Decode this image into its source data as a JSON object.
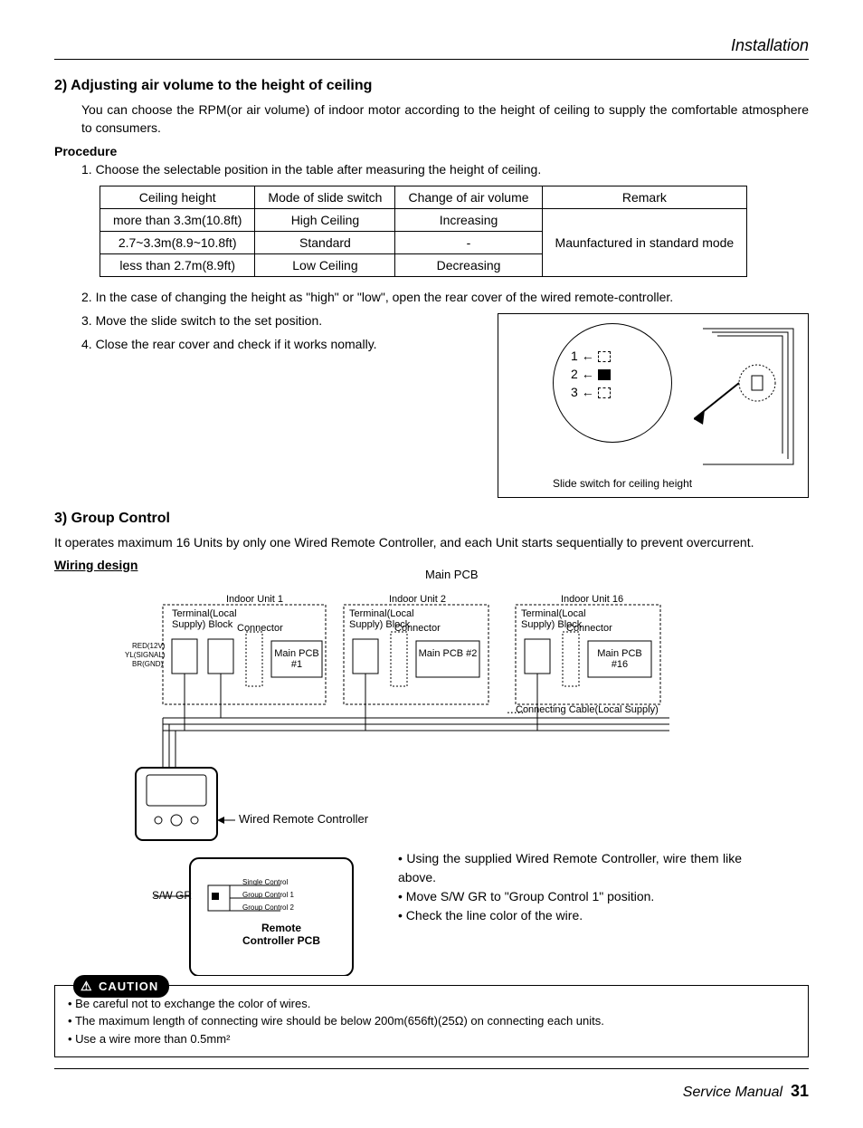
{
  "header": {
    "section": "Installation"
  },
  "s2": {
    "title": "2) Adjusting air volume to the height of ceiling",
    "intro": "You can choose the RPM(or air volume) of indoor motor according to the height of ceiling to supply the comfortable atmosphere to consumers.",
    "procedure_label": "Procedure",
    "step1": "1. Choose the selectable position in the table after measuring the height of ceiling.",
    "table": {
      "headers": [
        "Ceiling height",
        "Mode of slide switch",
        "Change of air volume",
        "Remark"
      ],
      "rows": [
        [
          "more than 3.3m(10.8ft)",
          "High Ceiling",
          "Increasing"
        ],
        [
          "2.7~3.3m(8.9~10.8ft)",
          "Standard",
          "-"
        ],
        [
          "less than 2.7m(8.9ft)",
          "Low Ceiling",
          "Decreasing"
        ]
      ],
      "remark": "Maunfactured in standard mode"
    },
    "step2": "2. In the case of changing the height as \"high\" or \"low\", open the rear cover of the wired remote-controller.",
    "step3": "3. Move the slide switch to the set position.",
    "step4": "4. Close the rear cover and check if it works nomally.",
    "switch": {
      "p1": "1",
      "p2": "2",
      "p3": "3",
      "caption": "Slide switch for ceiling height"
    }
  },
  "s3": {
    "title": "3) Group Control",
    "intro": "It operates maximum 16 Units by only one Wired Remote Controller, and each Unit starts sequentially to prevent overcurrent.",
    "wiring_label": "Wiring design",
    "main_pcb_top": "Main PCB",
    "units": {
      "u1": "Indoor Unit 1",
      "u2": "Indoor Unit 2",
      "u16": "Indoor Unit 16",
      "terminal": "Terminal(Local Supply) Block",
      "connector": "Connector",
      "pcb1": "Main PCB #1",
      "pcb2": "Main PCB #2",
      "pcb16": "Main PCB #16",
      "cable": "Connecting Cable(Local Supply)"
    },
    "wires": {
      "red": "RED(12V)",
      "yl": "YL(SIGNAL)",
      "br": "BR(GND)"
    },
    "wrc": "Wired Remote Controller",
    "sw_gr": "S/W GR",
    "sw_opts": [
      "Single Control",
      "Group Control 1",
      "Group Control 2"
    ],
    "rc_pcb": "Remote Controller PCB",
    "bullets": [
      "Using the supplied Wired Remote Controller, wire them like above.",
      "Move S/W GR to \"Group Control 1\" position.",
      "Check the line color of the wire."
    ]
  },
  "caution": {
    "label": "CAUTION",
    "items": [
      "Be careful not to exchange the color of wires.",
      "The maximum length of connecting wire should be below 200m(656ft)(25Ω) on connecting each units.",
      "Use a wire more than 0.5mm²"
    ]
  },
  "footer": {
    "text": "Service Manual",
    "page": "31"
  }
}
